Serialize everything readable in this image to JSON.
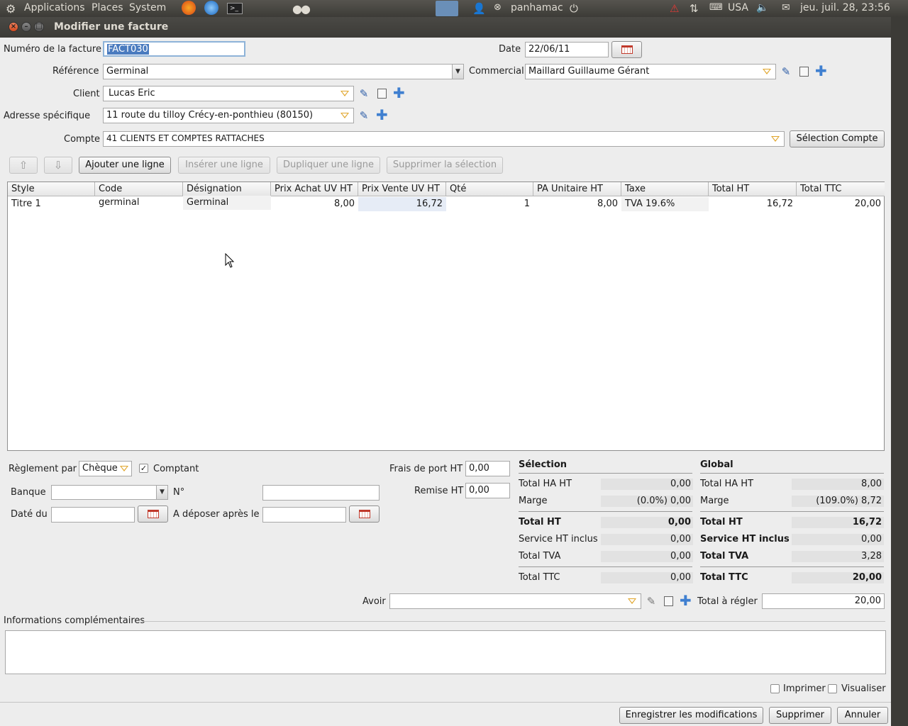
{
  "topbar": {
    "applications": "Applications",
    "places": "Places",
    "system": "System",
    "user": "panhamac",
    "keyboard": "USA",
    "clock": "jeu. juil. 28, 23:56"
  },
  "window": {
    "title": "Modifier une facture"
  },
  "form": {
    "numero_label": "Numéro de la facture",
    "numero_value": "FACT030",
    "date_label": "Date",
    "date_value": "22/06/11",
    "reference_label": "Référence",
    "reference_value": "Germinal",
    "commercial_label": "Commercial",
    "commercial_value": "Maillard Guillaume Gérant",
    "client_label": "Client",
    "client_value": "Lucas Eric",
    "adresse_label": "Adresse spécifique",
    "adresse_value": "11 route du tilloy Crécy-en-ponthieu (80150)",
    "compte_label": "Compte",
    "compte_value": "41 CLIENTS ET COMPTES RATTACHES",
    "selection_compte_button": "Sélection Compte"
  },
  "toolbar": {
    "up": "⇧",
    "down": "⇩",
    "add_line": "Ajouter une ligne",
    "insert_line": "Insérer une ligne",
    "duplicate_line": "Dupliquer une ligne",
    "delete_selection": "Supprimer la sélection"
  },
  "table": {
    "headers": [
      "Style",
      "Code",
      "Désignation",
      "Prix Achat UV HT",
      "Prix Vente UV HT",
      "Qté",
      "PA Unitaire HT",
      "Taxe",
      "Total HT",
      "Total TTC"
    ],
    "rows": [
      [
        "Titre 1",
        "germinal",
        "Germinal",
        "8,00",
        "16,72",
        "1",
        "8,00",
        "TVA 19.6%",
        "16,72",
        "20,00"
      ]
    ]
  },
  "payment": {
    "reglement_label": "Règlement par",
    "reglement_value": "Chèque",
    "comptant_label": "Comptant",
    "comptant_checked": true,
    "banque_label": "Banque",
    "banque_value": "",
    "numero_label": "N°",
    "numero_value": "",
    "date_du_label": "Daté du",
    "date_du_value": "",
    "deposer_label": "A déposer après le",
    "deposer_value": "",
    "frais_label": "Frais de port HT",
    "frais_value": "0,00",
    "remise_label": "Remise HT",
    "remise_value": "0,00"
  },
  "selection_totals": {
    "title": "Sélection",
    "total_ha_label": "Total HA HT",
    "total_ha": "0,00",
    "marge_label": "Marge",
    "marge": "(0.0%) 0,00",
    "total_ht_label": "Total HT",
    "total_ht": "0,00",
    "service_label": "Service HT inclus",
    "service": "0,00",
    "tva_label": "Total TVA",
    "tva": "0,00",
    "ttc_label": "Total TTC",
    "ttc": "0,00"
  },
  "global_totals": {
    "title": "Global",
    "total_ha_label": "Total HA HT",
    "total_ha": "8,00",
    "marge_label": "Marge",
    "marge": "(109.0%) 8,72",
    "total_ht_label": "Total HT",
    "total_ht": "16,72",
    "service_label": "Service HT inclus",
    "service": "0,00",
    "tva_label": "Total TVA",
    "tva": "3,28",
    "ttc_label": "Total TTC",
    "ttc": "20,00"
  },
  "avoir": {
    "label": "Avoir",
    "value": "",
    "total_regler_label": "Total à régler",
    "total_regler": "20,00"
  },
  "infos": {
    "label": "Informations complémentaires",
    "value": ""
  },
  "footer": {
    "imprimer": "Imprimer",
    "visualiser": "Visualiser",
    "save": "Enregistrer les modifications",
    "delete": "Supprimer",
    "cancel": "Annuler"
  }
}
